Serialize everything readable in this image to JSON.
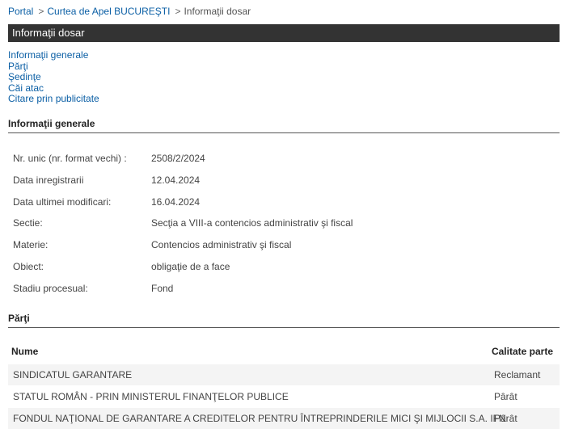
{
  "breadcrumb": {
    "items": [
      "Portal",
      "Curtea de Apel BUCUREŞTI",
      "Informaţii dosar"
    ],
    "separator": ">"
  },
  "header": {
    "title": "Informaţii dosar"
  },
  "nav": {
    "links": [
      "Informaţii generale",
      "Părţi",
      "Şedinţe",
      "Căi atac",
      "Citare prin publicitate"
    ]
  },
  "general": {
    "title": "Informaţii generale",
    "rows": [
      {
        "label": "Nr. unic (nr. format vechi) :",
        "value": "2508/2/2024"
      },
      {
        "label": "Data inregistrarii",
        "value": "12.04.2024"
      },
      {
        "label": "Data ultimei modificari:",
        "value": "16.04.2024"
      },
      {
        "label": "Sectie:",
        "value": "Secţia a VIII-a contencios administrativ şi fiscal"
      },
      {
        "label": "Materie:",
        "value": "Contencios administrativ şi fiscal"
      },
      {
        "label": "Obiect:",
        "value": "obligaţie de a face"
      },
      {
        "label": "Stadiu procesual:",
        "value": "Fond"
      }
    ]
  },
  "parti": {
    "title": "Părţi",
    "columns": [
      "Nume",
      "Calitate parte"
    ],
    "rows": [
      {
        "name": "SINDICATUL GARANTARE",
        "role": "Reclamant"
      },
      {
        "name": "STATUL ROMÂN - PRIN MINISTERUL FINANŢELOR PUBLICE",
        "role": "Pârât"
      },
      {
        "name": "FONDUL NAŢIONAL DE GARANTARE A CREDITELOR PENTRU ÎNTREPRINDERILE MICI ŞI MIJLOCII S.A. IFN",
        "role": "Pârât"
      }
    ]
  },
  "colors": {
    "link": "#0b5fa5",
    "titlebar": "#333333",
    "stripe": "#f4f4f4"
  }
}
